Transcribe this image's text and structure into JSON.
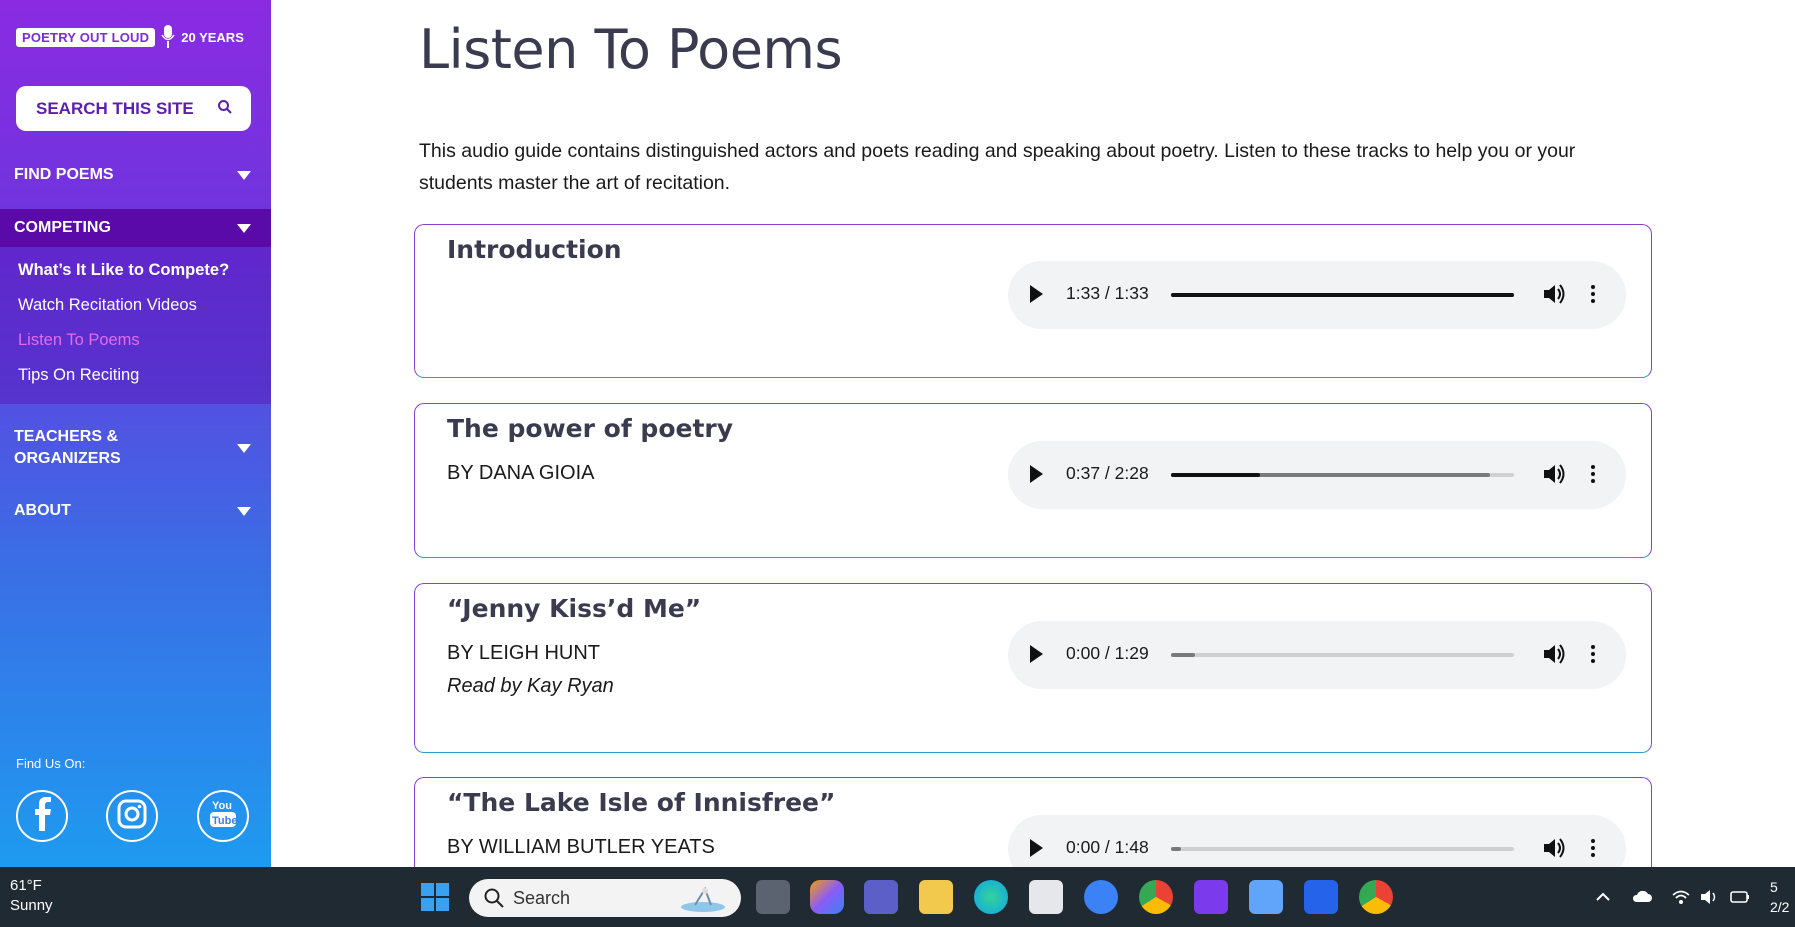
{
  "sidebar": {
    "logo": {
      "name": "POETRY OUT LOUD",
      "tagline": "20 YEARS"
    },
    "search_label": "SEARCH THIS SITE",
    "nav": {
      "find_poems": "FIND POEMS",
      "competing": "COMPETING",
      "teachers_line1": "TEACHERS &",
      "teachers_line2": "ORGANIZERS",
      "about": "ABOUT"
    },
    "competing_items": [
      {
        "label": "What’s It Like to Compete?"
      },
      {
        "label": "Watch Recitation Videos"
      },
      {
        "label": "Listen To Poems"
      },
      {
        "label": "Tips On Reciting"
      }
    ],
    "find_us_label": "Find Us On:",
    "social": [
      "facebook-icon",
      "instagram-icon",
      "youtube-icon"
    ],
    "gradient": [
      "#8a2be2",
      "#1e9bf0"
    ]
  },
  "main": {
    "title": "Listen To Poems",
    "intro": "This audio guide contains distinguished actors and poets reading and speaking about poetry. Listen to these tracks to help you or your students master the art of recitation.",
    "tracks": [
      {
        "title": "Introduction",
        "by": "",
        "read_by": "",
        "time": "1:33 / 1:33",
        "played": 1.0,
        "buffered": 1.0
      },
      {
        "title": "The power of poetry",
        "by": "BY DANA GIOIA",
        "read_by": "",
        "time": "0:37 / 2:28",
        "played": 0.26,
        "buffered": 0.93
      },
      {
        "title": "“Jenny Kiss’d Me”",
        "by": "BY LEIGH HUNT",
        "read_by": "Read by Kay Ryan",
        "time": "0:00 / 1:29",
        "played": 0.0,
        "buffered": 0.07
      },
      {
        "title": "“The Lake Isle of Innisfree”",
        "by": "BY WILLIAM BUTLER YEATS",
        "read_by": "",
        "time": "0:00 / 1:48",
        "played": 0.0,
        "buffered": 0.03
      }
    ]
  },
  "taskbar": {
    "weather_temp": "61°F",
    "weather_cond": "Sunny",
    "search_placeholder": "Search",
    "clock_line1": "5",
    "clock_line2": "2/2"
  }
}
